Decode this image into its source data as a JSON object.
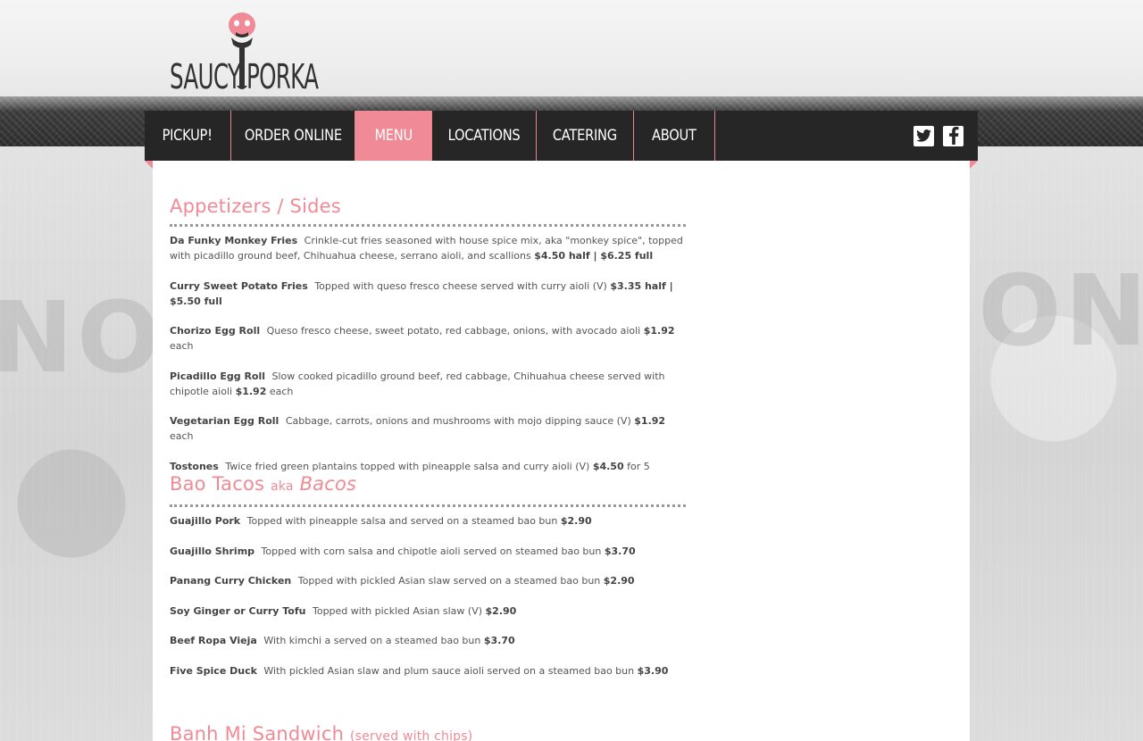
{
  "logo": {
    "word_left": "SAUCY",
    "word_right": "PORKA",
    "alt": "Saucy Porka"
  },
  "nav": {
    "items": [
      {
        "label": "PICKUP!"
      },
      {
        "label": "ORDER ONLINE"
      },
      {
        "label": "MENU",
        "active": true
      },
      {
        "label": "LOCATIONS"
      },
      {
        "label": "CATERING"
      },
      {
        "label": "ABOUT"
      }
    ],
    "social": [
      "twitter-icon",
      "facebook-icon"
    ]
  },
  "colors": {
    "accent": "#f08a96",
    "nav_bg": "#262626",
    "text": "#555555"
  },
  "sections": [
    {
      "title": "Appetizers / Sides",
      "items": [
        {
          "name": "Da Funky Monkey Fries",
          "desc": "Crinkle-cut fries seasoned with house spice mix, aka \"monkey spice\", topped with picadillo ground beef, Chihuahua cheese, serrano aioli, and scallions",
          "price": "$4.50 half  | $6.25 full",
          "suffix": ""
        },
        {
          "name": "Curry Sweet Potato Fries",
          "desc": "Topped with queso fresco cheese served with curry aioli (V)",
          "price": "$3.35 half  | $5.50 full",
          "suffix": ""
        },
        {
          "name": "Chorizo Egg Roll",
          "desc": "Queso fresco cheese, sweet potato, red cabbage, onions, with avocado aioli",
          "price": "$1.92",
          "suffix": "each"
        },
        {
          "name": "Picadillo Egg Roll",
          "desc": "Slow cooked picadillo ground beef, red cabbage, Chihuahua cheese served with chipotle aioli",
          "price": "$1.92",
          "suffix": "each"
        },
        {
          "name": "Vegetarian Egg Roll",
          "desc": "Cabbage, carrots, onions and mushrooms with mojo dipping sauce (V)",
          "price": "$1.92",
          "suffix": "each"
        },
        {
          "name": "Tostones",
          "desc": "Twice fried green plantains topped with pineapple salsa and curry aioli (V)",
          "price": "$4.50",
          "suffix": "for 5"
        }
      ]
    },
    {
      "title": "Bao Tacos",
      "title_small": "aka",
      "title_italic": "Bacos",
      "items": [
        {
          "name": "Guajillo Pork",
          "desc": "Topped with pineapple salsa and served on a steamed bao bun",
          "price": "$2.90",
          "suffix": ""
        },
        {
          "name": "Guajillo Shrimp",
          "desc": "Topped with corn salsa and chipotle aioli served on steamed bao bun",
          "price": "$3.70",
          "suffix": ""
        },
        {
          "name": "Panang Curry Chicken",
          "desc": "Topped with pickled Asian slaw served on a steamed bao bun",
          "price": "$2.90",
          "suffix": ""
        },
        {
          "name": "Soy Ginger or Curry Tofu",
          "desc": "Topped with pickled Asian slaw (V) ",
          "price": "$2.90",
          "suffix": ""
        },
        {
          "name": "Beef Ropa Vieja",
          "desc": "With kimchi a served on a steamed bao bun",
          "price": "$3.70",
          "suffix": ""
        },
        {
          "name": "Five Spice Duck",
          "desc": "With pickled Asian slaw and plum sauce aioli served on a steamed bao bun",
          "price": "$3.90",
          "suffix": ""
        }
      ]
    },
    {
      "title": "Banh Mi Sandwich",
      "title_small": "(served with chips)"
    }
  ]
}
